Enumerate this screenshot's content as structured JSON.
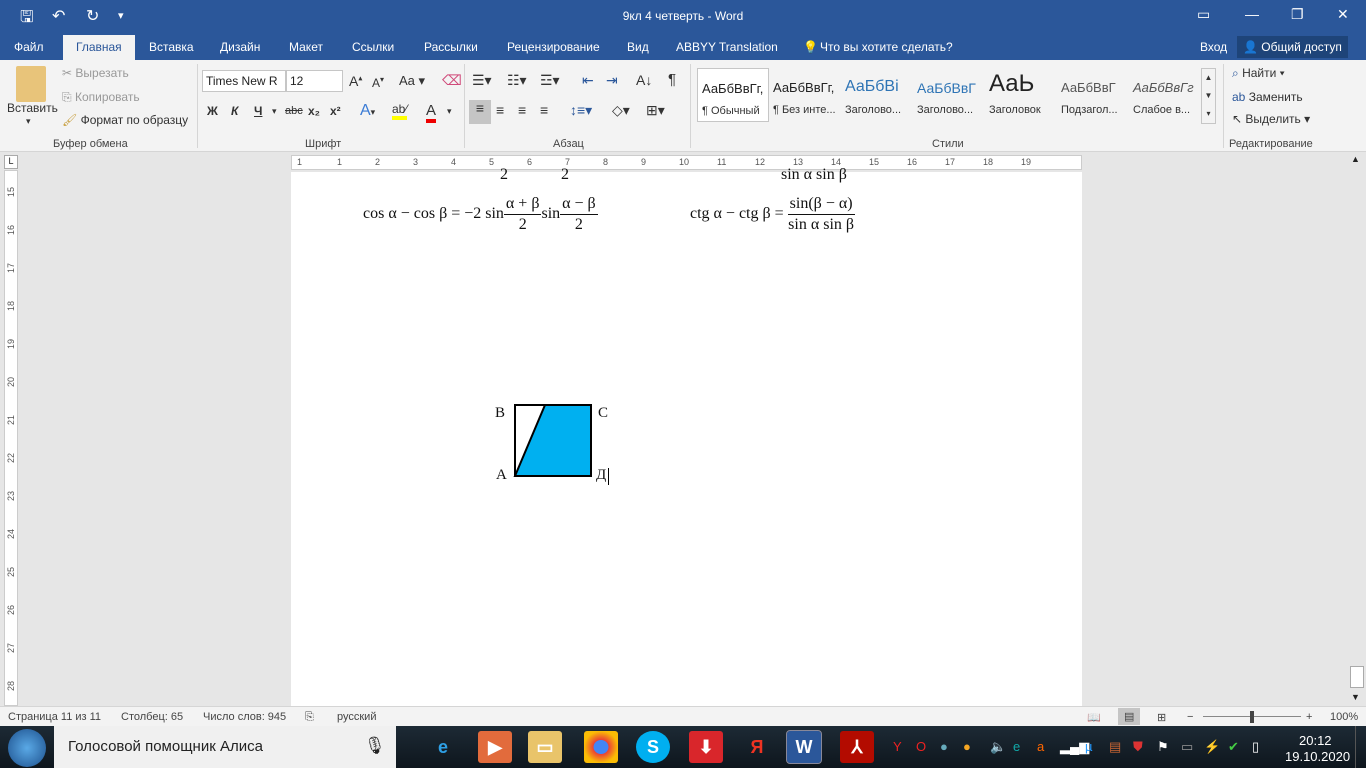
{
  "title": "9кл 4 четверть - Word",
  "menu": {
    "tabs": [
      "Файл",
      "Главная",
      "Вставка",
      "Дизайн",
      "Макет",
      "Ссылки",
      "Рассылки",
      "Рецензирование",
      "Вид",
      "ABBYY Translation"
    ],
    "tell_me": "Что вы хотите сделать?",
    "signin": "Вход",
    "share": "Общий доступ"
  },
  "ribbon": {
    "clipboard": {
      "paste": "Вставить",
      "cut": "Вырезать",
      "copy": "Копировать",
      "format_painter": "Формат по образцу",
      "label": "Буфер обмена"
    },
    "font": {
      "name": "Times New R",
      "size": "12",
      "case": "Aa",
      "label": "Шрифт",
      "bold": "Ж",
      "italic": "К",
      "underline": "Ч",
      "strike": "abc",
      "sub": "x₂",
      "sup": "x²"
    },
    "paragraph": {
      "label": "Абзац"
    },
    "styles": {
      "label": "Стили",
      "items": [
        {
          "preview": "АаБбВвГг,",
          "name": "¶ Обычный"
        },
        {
          "preview": "АаБбВвГг,",
          "name": "¶ Без инте..."
        },
        {
          "preview": "АаБбВі",
          "name": "Заголово..."
        },
        {
          "preview": "АаБбВвГ",
          "name": "Заголово..."
        },
        {
          "preview": "АаЬ",
          "name": "Заголовок"
        },
        {
          "preview": "АаБбВвГ",
          "name": "Подзагол..."
        },
        {
          "preview": "АаБбВвГг",
          "name": "Слабое в..."
        }
      ]
    },
    "editing": {
      "find": "Найти",
      "replace": "Заменить",
      "select": "Выделить",
      "label": "Редактирование"
    }
  },
  "ruler": {
    "h": [
      "1",
      "1",
      "2",
      "3",
      "4",
      "5",
      "6",
      "7",
      "8",
      "9",
      "10",
      "11",
      "12",
      "13",
      "14",
      "15",
      "16",
      "17",
      "18",
      "19"
    ],
    "v": [
      "15",
      "16",
      "17",
      "18",
      "19",
      "20",
      "21",
      "22",
      "23",
      "24",
      "25",
      "26",
      "27",
      "28"
    ]
  },
  "document": {
    "formula1": {
      "lhs": "cos α − cos β = −2 sin",
      "f1n": "α + β",
      "f1d": "2",
      "mid": "sin",
      "f2n": "α − β",
      "f2d": "2"
    },
    "formula2": {
      "lhs": "ctg α − ctg β =",
      "n": "sin(β − α)",
      "d": "sin α sin β"
    },
    "partial_top": {
      "a": "2",
      "b": "2",
      "c": "sin α sin β"
    },
    "figure": {
      "B": "В",
      "C": "С",
      "A": "А",
      "D": "Д",
      "fill": "#00b0f0"
    }
  },
  "status": {
    "page": "Страница 11 из 11",
    "column": "Столбец: 65",
    "words": "Число слов: 945",
    "lang": "русский",
    "zoom": "100%",
    "zoom_minus": "−",
    "zoom_plus": "+"
  },
  "taskbar": {
    "assistant": "Голосовой помощник Алиса",
    "time": "20:12",
    "date": "19.10.2020"
  }
}
